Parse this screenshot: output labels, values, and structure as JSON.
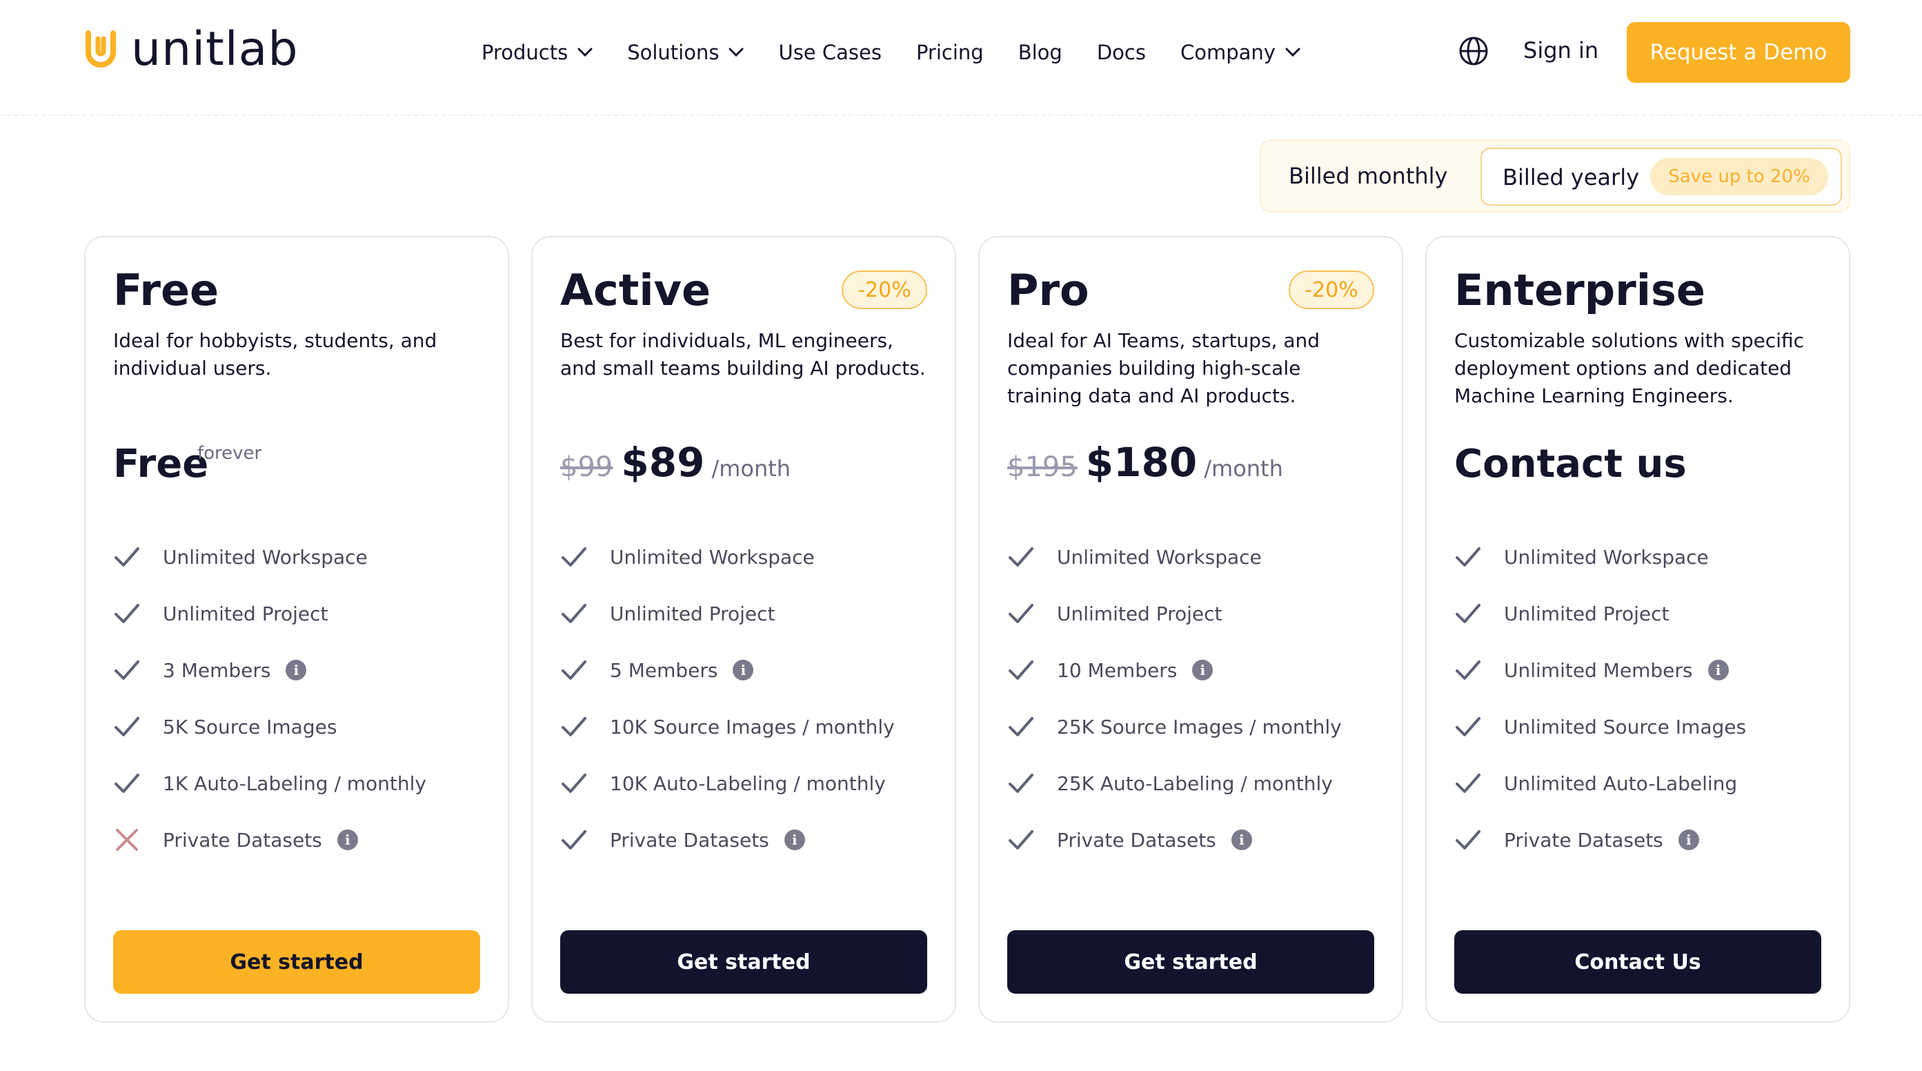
{
  "header": {
    "logo_text": "unitlab",
    "nav": [
      {
        "label": "Products",
        "dropdown": true
      },
      {
        "label": "Solutions",
        "dropdown": true
      },
      {
        "label": "Use Cases",
        "dropdown": false
      },
      {
        "label": "Pricing",
        "dropdown": false
      },
      {
        "label": "Blog",
        "dropdown": false
      },
      {
        "label": "Docs",
        "dropdown": false
      },
      {
        "label": "Company",
        "dropdown": true
      }
    ],
    "globe_icon": "globe-icon",
    "sign_in": "Sign in",
    "demo_button": "Request a Demo"
  },
  "billing": {
    "monthly": "Billed monthly",
    "yearly": "Billed yearly",
    "save_badge": "Save up to 20%",
    "selected": "yearly"
  },
  "colors": {
    "accent": "#fbb224",
    "dark": "#12142e",
    "text": "#14142b",
    "muted": "#4a4a5c"
  },
  "plans": [
    {
      "name": "Free",
      "discount": "",
      "description": "Ideal for hobbyists, students, and individual users.",
      "price_label": "Free",
      "price_note": "forever",
      "features": [
        {
          "text": "Unlimited Workspace",
          "included": true,
          "info": false
        },
        {
          "text": "Unlimited Project",
          "included": true,
          "info": false
        },
        {
          "text": "3 Members",
          "included": true,
          "info": true
        },
        {
          "text": "5K Source Images",
          "included": true,
          "info": false
        },
        {
          "text": "1K Auto-Labeling / monthly",
          "included": true,
          "info": false
        },
        {
          "text": "Private Datasets",
          "included": false,
          "info": true
        }
      ],
      "cta": "Get started"
    },
    {
      "name": "Active",
      "discount": "-20%",
      "description": "Best for individuals, ML engineers, and small teams building AI products.",
      "price_old": "$99",
      "price_new": "$89",
      "price_unit": "/month",
      "features": [
        {
          "text": "Unlimited Workspace",
          "included": true,
          "info": false
        },
        {
          "text": "Unlimited Project",
          "included": true,
          "info": false
        },
        {
          "text": "5 Members",
          "included": true,
          "info": true
        },
        {
          "text": "10K Source Images / monthly",
          "included": true,
          "info": false
        },
        {
          "text": "10K Auto-Labeling / monthly",
          "included": true,
          "info": false
        },
        {
          "text": "Private Datasets",
          "included": true,
          "info": true
        }
      ],
      "cta": "Get started"
    },
    {
      "name": "Pro",
      "discount": "-20%",
      "description": "Ideal for AI Teams, startups, and companies building high-scale training data and AI products.",
      "price_old": "$195",
      "price_new": "$180",
      "price_unit": "/month",
      "features": [
        {
          "text": "Unlimited Workspace",
          "included": true,
          "info": false
        },
        {
          "text": "Unlimited Project",
          "included": true,
          "info": false
        },
        {
          "text": "10 Members",
          "included": true,
          "info": true
        },
        {
          "text": "25K Source Images / monthly",
          "included": true,
          "info": false
        },
        {
          "text": "25K Auto-Labeling / monthly",
          "included": true,
          "info": false
        },
        {
          "text": "Private Datasets",
          "included": true,
          "info": true
        }
      ],
      "cta": "Get started"
    },
    {
      "name": "Enterprise",
      "discount": "",
      "description": "Customizable solutions with specific deployment options and dedicated Machine Learning Engineers.",
      "price_label": "Contact us",
      "features": [
        {
          "text": "Unlimited Workspace",
          "included": true,
          "info": false
        },
        {
          "text": "Unlimited Project",
          "included": true,
          "info": false
        },
        {
          "text": "Unlimited Members",
          "included": true,
          "info": true
        },
        {
          "text": "Unlimited Source Images",
          "included": true,
          "info": false
        },
        {
          "text": "Unlimited Auto-Labeling",
          "included": true,
          "info": false
        },
        {
          "text": "Private Datasets",
          "included": true,
          "info": true
        }
      ],
      "cta": "Contact Us"
    }
  ]
}
